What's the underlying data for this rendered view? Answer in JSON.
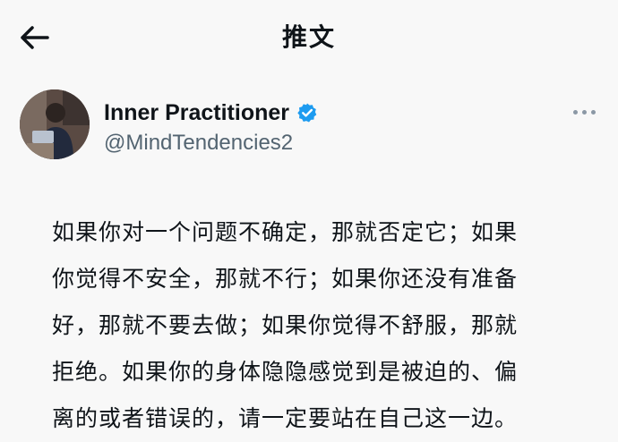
{
  "header": {
    "back_icon": "arrow-left-icon",
    "title": "推文"
  },
  "author": {
    "name": "Inner Practitioner",
    "handle": "@MindTendencies2",
    "verified_icon": "verified-badge-icon",
    "verified_color": "#1d9bf0",
    "more_icon": "more-horizontal-icon"
  },
  "tweet": {
    "text": "如果你对一个问题不确定，那就否定它；如果\n你觉得不安全，那就不行；如果你还没有准备\n好，那就不要去做；如果你觉得不舒服，那就\n拒绝。如果你的身体隐隐感觉到是被迫的、偏\n离的或者错误的，请一定要站在自己这一边。"
  }
}
